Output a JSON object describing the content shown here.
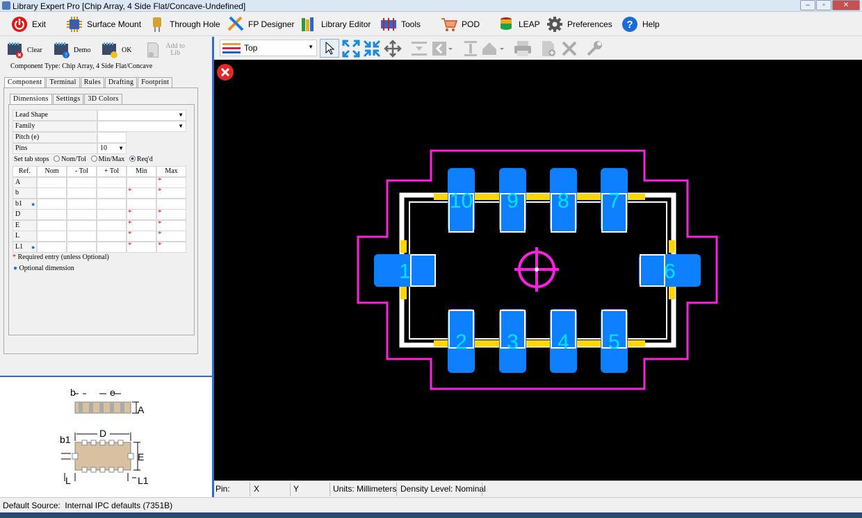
{
  "window": {
    "title": "Library Expert Pro [Chip Array, 4 Side Flat/Concave-Undefined]"
  },
  "toolbar": {
    "items": [
      {
        "label": "Exit",
        "icon": "power-icon"
      },
      {
        "label": "Surface Mount",
        "icon": "chip-icon"
      },
      {
        "label": "Through Hole",
        "icon": "through-hole-icon"
      },
      {
        "label": "FP Designer",
        "icon": "pencil-ruler-icon"
      },
      {
        "label": "Library Editor",
        "icon": "books-icon"
      },
      {
        "label": "Tools",
        "icon": "tools-icon"
      },
      {
        "label": "POD",
        "icon": "cart-icon"
      },
      {
        "label": "LEAP",
        "icon": "database-icon"
      },
      {
        "label": "Preferences",
        "icon": "gear-icon"
      },
      {
        "label": "Help",
        "icon": "help-icon"
      }
    ]
  },
  "left": {
    "buttons": {
      "clear": "Clear",
      "demo": "Demo",
      "ok": "OK",
      "add_to_lib": "Add to Lib"
    },
    "component_type": "Component Type: Chip Array, 4 Side Flat/Concave",
    "tabs1": [
      "Component",
      "Terminal",
      "Rules",
      "Drafting",
      "Footprint"
    ],
    "tabs2": [
      "Dimensions",
      "Settings",
      "3D Colors"
    ],
    "fields": {
      "lead_shape": "Lead Shape",
      "family": "Family",
      "pitch": "Pitch (e)",
      "pins": "Pins",
      "pins_value": "10"
    },
    "tabstops": {
      "label": "Set tab stops",
      "opt1": "Nom/Tol",
      "opt2": "Min/Max",
      "opt3": "Req'd"
    },
    "table": {
      "headers": [
        "Ref.",
        "Nom",
        "- Tol",
        "+ Tol",
        "Min",
        "Max"
      ],
      "rows": [
        "A",
        "b",
        "b1",
        "D",
        "E",
        "L",
        "L1"
      ]
    },
    "legend": {
      "required": "Required entry (unless Optional)",
      "optional": "Optional dimension"
    }
  },
  "diagram": {
    "labels": {
      "b": "b",
      "e": "e",
      "A": "A",
      "D": "D",
      "b1": "b1",
      "E": "E",
      "L": "L",
      "L1": "L1"
    }
  },
  "canvas_toolbar": {
    "layer": "Top"
  },
  "canvas": {
    "pads_top": [
      "10",
      "9",
      "8",
      "7"
    ],
    "pads_bottom": [
      "2",
      "3",
      "4",
      "5"
    ],
    "pad_left": "1",
    "pad_right": "6",
    "colors": {
      "pad": "#0d7fff",
      "courtyard": "#ff1fe3",
      "silk": "#ffffff",
      "assembly": "#ffd700",
      "pad_text": "#00e5ff"
    }
  },
  "status": {
    "pin": "Pin:",
    "x": "X",
    "y": "Y",
    "units": "Units: Millimeters",
    "density": "Density Level: Nominal"
  },
  "source": {
    "text": "Default Source:  Internal IPC defaults (7351B)"
  }
}
